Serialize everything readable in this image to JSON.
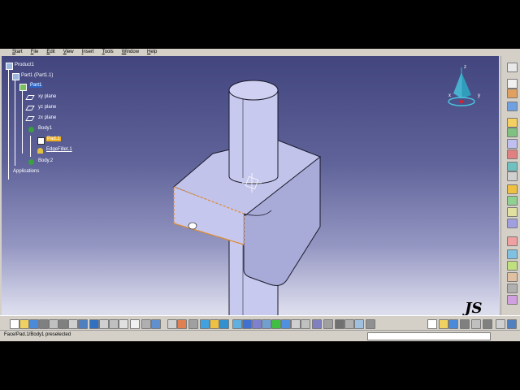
{
  "menu": [
    {
      "label": "Start",
      "underline": "S"
    },
    {
      "label": "File",
      "underline": "F"
    },
    {
      "label": "Edit",
      "underline": "E"
    },
    {
      "label": "View",
      "underline": "V"
    },
    {
      "label": "Insert",
      "underline": "I"
    },
    {
      "label": "Tools",
      "underline": "T"
    },
    {
      "label": "Window",
      "underline": "W"
    },
    {
      "label": "Help",
      "underline": "H"
    }
  ],
  "tree": {
    "product": "Product1",
    "part_instance": "Part1 (Part1.1)",
    "part": "Part1",
    "xy_plane": "xy plane",
    "yz_plane": "yz plane",
    "zx_plane": "zx plane",
    "body1": "Body1",
    "pad": "Pad.1",
    "fillet": "EdgeFillet.1",
    "body2": "Body.2",
    "applications": "Applications"
  },
  "compass": {
    "z": "z",
    "x": "x",
    "y": "y"
  },
  "status": {
    "message": "Face/Pad.1/Body1 preselected"
  },
  "watermark": {
    "text": "JS"
  },
  "colors": {
    "selected_tree_bg": "#f0b020",
    "part_highlight": "#2a64c8",
    "solid": "#c5c6ec",
    "preselect": "#e08a2c"
  }
}
